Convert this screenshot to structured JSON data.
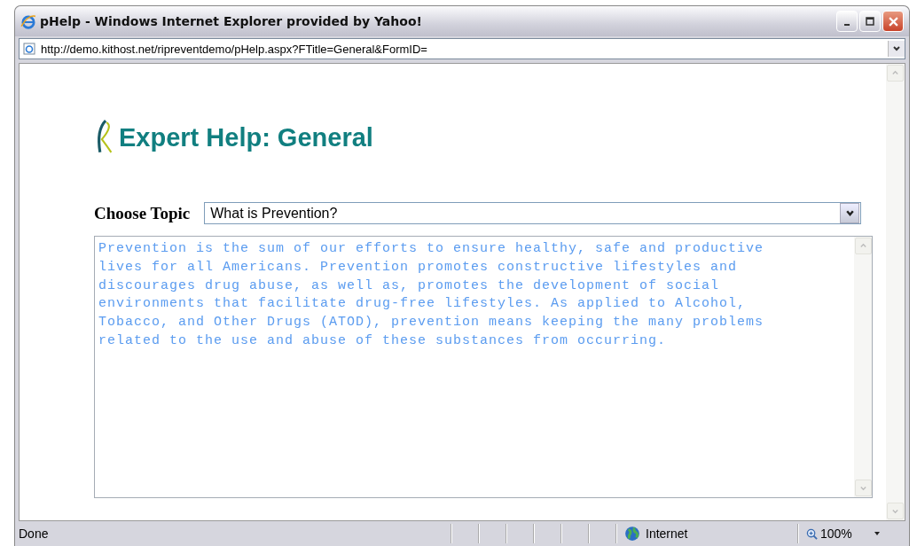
{
  "window": {
    "title": "pHelp - Windows Internet Explorer provided by Yahoo!"
  },
  "address_bar": {
    "url": "http://demo.kithost.net/ripreventdemo/pHelp.aspx?FTitle=General&FormID="
  },
  "page": {
    "heading": "Expert Help: General",
    "topic_label": "Choose Topic",
    "topic_value": "What is Prevention?",
    "content": "Prevention is the sum of our efforts to ensure healthy, safe and productive lives for all Americans. Prevention promotes constructive lifestyles and discourages drug abuse, as well as, promotes the development of social environments that facilitate drug-free lifestyles. As applied to Alcohol, Tobacco, and Other Drugs (ATOD), prevention means keeping the many problems related to the use and abuse of these substances from occurring."
  },
  "status_bar": {
    "status": "Done",
    "zone": "Internet",
    "zoom": "100%"
  }
}
